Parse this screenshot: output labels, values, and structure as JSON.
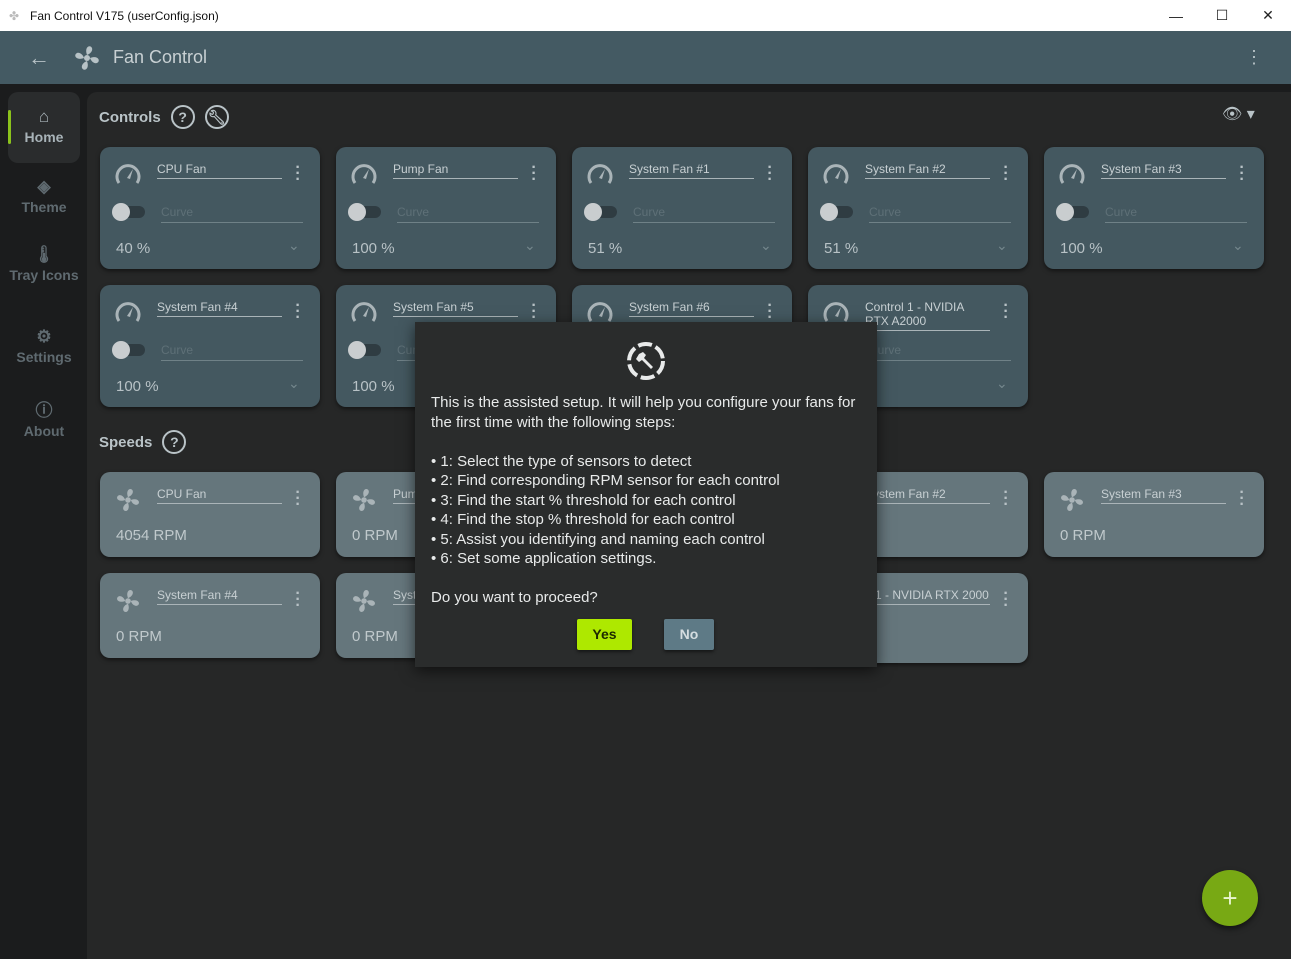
{
  "window": {
    "title": "Fan Control V175 (userConfig.json)"
  },
  "header": {
    "title": "Fan Control"
  },
  "sidebar": {
    "items": [
      {
        "label": "Home",
        "icon": "home-icon"
      },
      {
        "label": "Theme",
        "icon": "paint-bucket-icon"
      },
      {
        "label": "Tray Icons",
        "icon": "thermometer-icon"
      },
      {
        "label": "Settings",
        "icon": "gear-icon"
      },
      {
        "label": "About",
        "icon": "info-icon"
      }
    ]
  },
  "controls": {
    "title": "Controls",
    "cards": [
      {
        "name": "CPU Fan",
        "curve": "Curve",
        "value": "40 %"
      },
      {
        "name": "Pump Fan",
        "curve": "Curve",
        "value": "100 %"
      },
      {
        "name": "System Fan #1",
        "curve": "Curve",
        "value": "51 %"
      },
      {
        "name": "System Fan #2",
        "curve": "Curve",
        "value": "51 %"
      },
      {
        "name": "System Fan #3",
        "curve": "Curve",
        "value": "100 %"
      },
      {
        "name": "System Fan #4",
        "curve": "Curve",
        "value": "100 %"
      },
      {
        "name": "System Fan #5",
        "curve": "Curve",
        "value": "100 %"
      },
      {
        "name": "System Fan #6",
        "curve": "Curve",
        "value": ""
      },
      {
        "name": "Control 1 - NVIDIA RTX A2000",
        "curve": "Curve",
        "value": ""
      }
    ]
  },
  "speeds": {
    "title": "Speeds",
    "cards": [
      {
        "name": "CPU Fan",
        "value": "4054 RPM"
      },
      {
        "name": "Pump Fan",
        "value": "0 RPM"
      },
      {
        "name": "System Fan #2",
        "value": "PM"
      },
      {
        "name": "System Fan #3",
        "value": "0 RPM"
      },
      {
        "name": "System Fan #4",
        "value": "0 RPM"
      },
      {
        "name": "Syst",
        "value": "0 RPM"
      },
      {
        "name": "n 1 - NVIDIA RTX 2000",
        "value": "PM"
      }
    ]
  },
  "dialog": {
    "intro": "This is the assisted setup. It will help you configure your fans for the first time with the following steps:",
    "steps": [
      "• 1: Select the type of sensors to detect",
      "• 2: Find corresponding RPM sensor for each control",
      "• 3: Find the start % threshold for each control",
      "• 4: Find the stop % threshold for each control",
      "• 5: Assist you identifying and naming each control",
      "• 6: Set some application settings."
    ],
    "question": "Do you want to proceed?",
    "yes": "Yes",
    "no": "No"
  },
  "colors": {
    "accent": "#aee800",
    "header": "#445a63",
    "control_card": "#445860",
    "speed_card": "#65767c"
  }
}
